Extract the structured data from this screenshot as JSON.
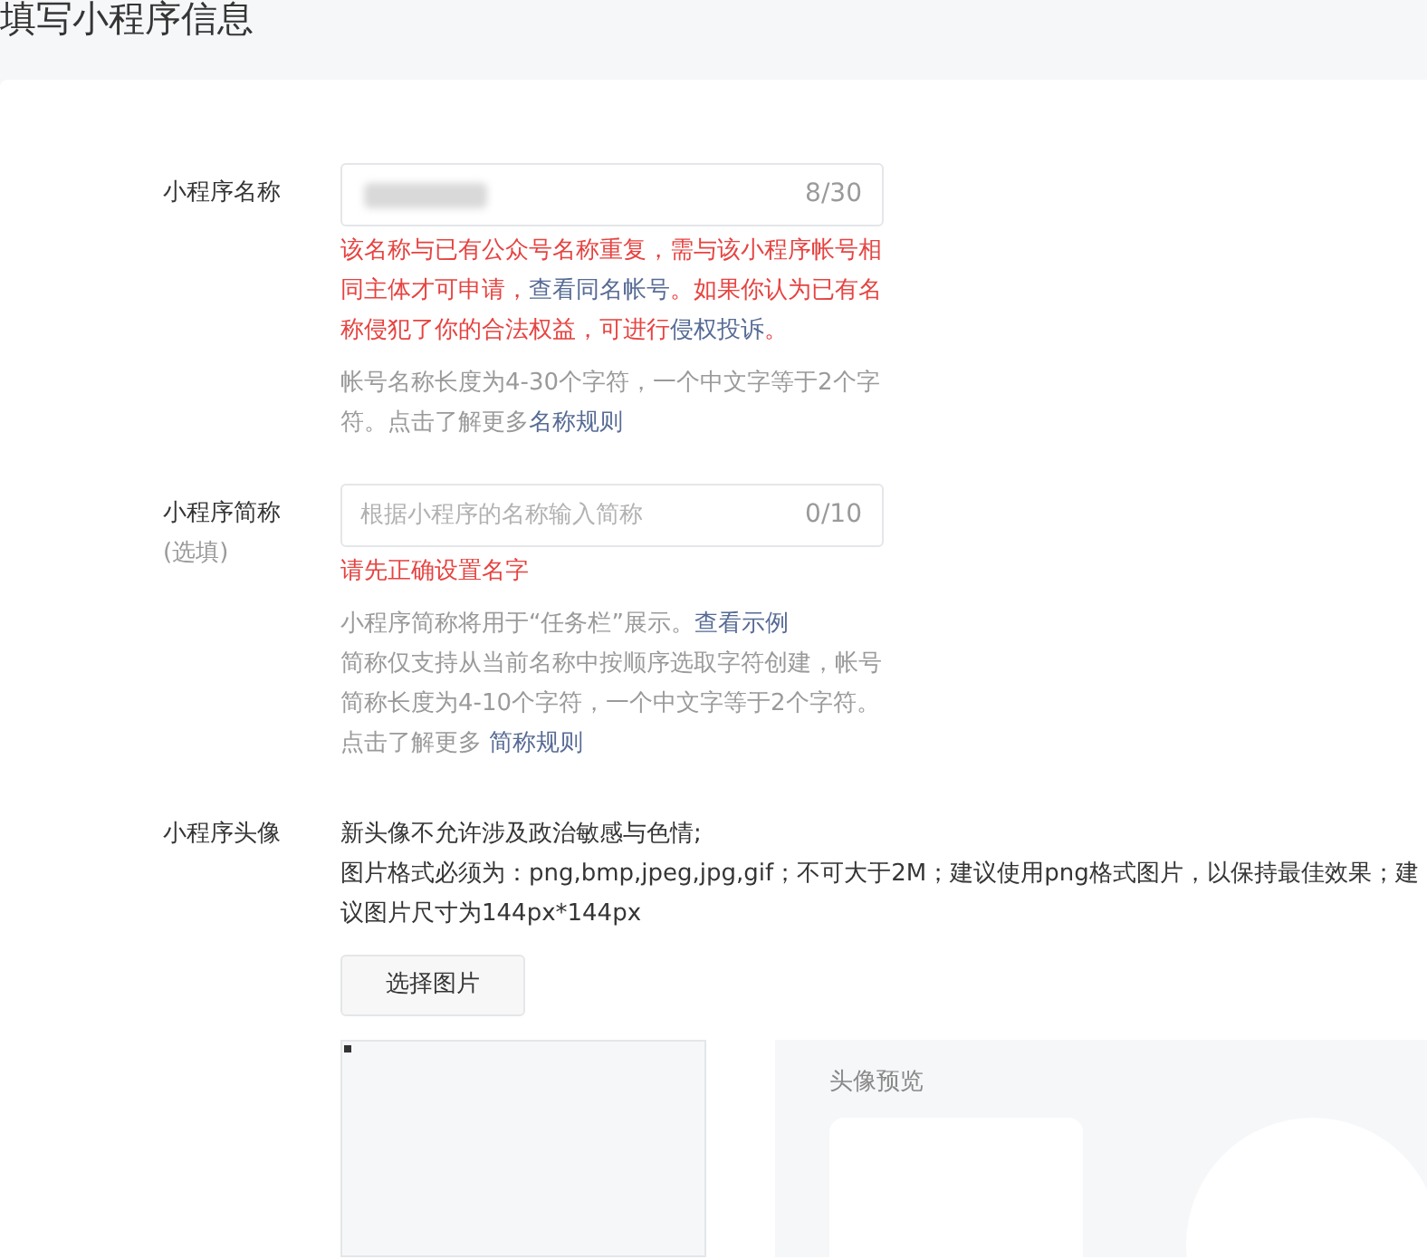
{
  "page_title": "填写小程序信息",
  "fields": [
    {
      "kind": "input",
      "label": "小程序名称",
      "counter": "8/30",
      "redacted_value": true,
      "error": [
        {
          "kind": "text",
          "text": "该名称与已有公众号名称重复，需与该小程序帐号相同主体才可申请，"
        },
        {
          "kind": "link",
          "text": "查看同名帐号"
        },
        {
          "kind": "text",
          "text": "。如果你认为已有名称侵犯了你的合法权益，可进行"
        },
        {
          "kind": "link",
          "text": "侵权投诉"
        },
        {
          "kind": "text",
          "text": "。"
        }
      ],
      "hints": [
        [
          {
            "kind": "text",
            "text": "帐号名称长度为4-30个字符，一个中文字等于2个字符。点击了解更多"
          },
          {
            "kind": "link",
            "text": "名称规则"
          }
        ]
      ]
    },
    {
      "kind": "input",
      "label": "小程序简称",
      "sublabel": "(选填)",
      "counter": "0/10",
      "placeholder": "根据小程序的名称输入简称",
      "redacted_value": false,
      "error": [
        {
          "kind": "text",
          "text": "请先正确设置名字"
        }
      ],
      "hints": [
        [
          {
            "kind": "text",
            "text": "小程序简称将用于“任务栏”展示。"
          },
          {
            "kind": "link",
            "text": "查看示例"
          }
        ],
        [
          {
            "kind": "text",
            "text": "简称仅支持从当前名称中按顺序选取字符创建，帐号简称长度为4-10个字符，一个中文字等于2个字符。点击了解更多 "
          },
          {
            "kind": "link",
            "text": "简称规则"
          }
        ]
      ]
    },
    {
      "kind": "avatar",
      "label": "小程序头像",
      "notes": [
        "新头像不允许涉及政治敏感与色情;",
        "图片格式必须为：png,bmp,jpeg,jpg,gif；不可大于2M；建议使用png格式图片，以保持最佳效果；建议图片尺寸为144px*144px"
      ],
      "button": "选择图片",
      "preview_title": "头像预览"
    }
  ]
}
